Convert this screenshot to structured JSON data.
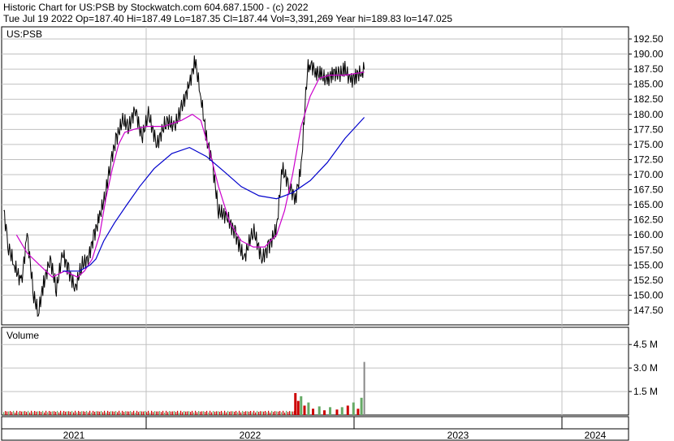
{
  "header": {
    "title": "Historic Chart for US:PSB by Stockwatch.com 604.687.1500 - (c) 2022",
    "stats": "Tue Jul 19 2022   Op=187.40   Hi=187.49   Lo=187.35   Cl=187.44   Vol=3,391,269   Year hi=189.83   lo=147.025"
  },
  "colors": {
    "price": "#000000",
    "ma_short": "#cc00cc",
    "ma_long": "#0000cc",
    "vol_up": "#66aa66",
    "vol_down": "#cc0000",
    "grid": "#c0c0c0",
    "last_volume": "#888888"
  },
  "chart_data": [
    {
      "type": "line",
      "label": "US:PSB",
      "x_axis": {
        "labels": [
          "2021",
          "2022",
          "2023",
          "2024"
        ],
        "year_start_dates": [
          "2021-01-01",
          "2022-01-01",
          "2023-01-01",
          "2024-01-01",
          "2024-12-31"
        ]
      },
      "y_axis": {
        "ticks": [
          "192.50",
          "190.00",
          "187.50",
          "185.00",
          "182.50",
          "180.00",
          "177.50",
          "175.00",
          "172.50",
          "170.00",
          "167.50",
          "165.00",
          "162.50",
          "160.00",
          "157.50",
          "155.00",
          "152.50",
          "150.00",
          "147.50"
        ],
        "range": [
          145.0,
          193.5
        ]
      },
      "grid": true,
      "series": [
        {
          "role": "price",
          "points": [
            [
              "2020-07-20",
              164
            ],
            [
              "2020-08-01",
              158
            ],
            [
              "2020-08-15",
              155
            ],
            [
              "2020-09-01",
              152
            ],
            [
              "2020-09-15",
              160
            ],
            [
              "2020-10-01",
              150
            ],
            [
              "2020-10-12",
              147
            ],
            [
              "2020-10-25",
              152
            ],
            [
              "2020-11-10",
              156
            ],
            [
              "2020-11-25",
              151
            ],
            [
              "2020-12-10",
              157
            ],
            [
              "2020-12-25",
              154
            ],
            [
              "2021-01-10",
              151
            ],
            [
              "2021-01-25",
              155
            ],
            [
              "2021-02-10",
              156
            ],
            [
              "2021-02-25",
              160
            ],
            [
              "2021-03-10",
              163
            ],
            [
              "2021-03-25",
              167
            ],
            [
              "2021-04-05",
              172
            ],
            [
              "2021-04-20",
              176
            ],
            [
              "2021-05-05",
              179
            ],
            [
              "2021-05-20",
              178
            ],
            [
              "2021-06-05",
              181
            ],
            [
              "2021-06-20",
              176
            ],
            [
              "2021-07-05",
              180
            ],
            [
              "2021-07-20",
              175
            ],
            [
              "2021-08-05",
              179
            ],
            [
              "2021-08-20",
              178
            ],
            [
              "2021-09-01",
              181
            ],
            [
              "2021-09-15",
              185
            ],
            [
              "2021-09-25",
              189
            ],
            [
              "2021-10-05",
              183
            ],
            [
              "2021-10-15",
              176
            ],
            [
              "2021-10-25",
              172
            ],
            [
              "2021-11-05",
              164
            ],
            [
              "2021-11-20",
              163
            ],
            [
              "2021-12-05",
              160
            ],
            [
              "2021-12-20",
              156
            ],
            [
              "2022-01-05",
              161
            ],
            [
              "2022-01-20",
              156
            ],
            [
              "2022-02-01",
              158
            ],
            [
              "2022-02-15",
              161
            ],
            [
              "2022-02-25",
              171
            ],
            [
              "2022-03-10",
              168
            ],
            [
              "2022-03-20",
              166
            ],
            [
              "2022-03-30",
              171
            ],
            [
              "2022-04-10",
              187.5
            ],
            [
              "2022-04-15",
              188.5
            ],
            [
              "2022-04-25",
              187
            ],
            [
              "2022-05-05",
              186.5
            ],
            [
              "2022-05-15",
              185.5
            ],
            [
              "2022-05-25",
              187
            ],
            [
              "2022-06-05",
              186.5
            ],
            [
              "2022-06-15",
              187.5
            ],
            [
              "2022-06-25",
              185.5
            ],
            [
              "2022-07-05",
              186.5
            ],
            [
              "2022-07-15",
              187
            ],
            [
              "2022-07-19",
              187.44
            ]
          ]
        },
        {
          "role": "moving-average-short",
          "points": [
            [
              "2020-08-20",
              160
            ],
            [
              "2020-09-15",
              157
            ],
            [
              "2020-10-15",
              155
            ],
            [
              "2020-11-15",
              153
            ],
            [
              "2020-12-15",
              154
            ],
            [
              "2021-01-15",
              153
            ],
            [
              "2021-02-01",
              154
            ],
            [
              "2021-02-20",
              156
            ],
            [
              "2021-03-10",
              160
            ],
            [
              "2021-03-25",
              166
            ],
            [
              "2021-04-10",
              171
            ],
            [
              "2021-04-25",
              175
            ],
            [
              "2021-05-10",
              177
            ],
            [
              "2021-06-01",
              177.5
            ],
            [
              "2021-07-01",
              178
            ],
            [
              "2021-08-01",
              178
            ],
            [
              "2021-09-01",
              179
            ],
            [
              "2021-09-20",
              180
            ],
            [
              "2021-10-05",
              179
            ],
            [
              "2021-10-20",
              174
            ],
            [
              "2021-11-05",
              168
            ],
            [
              "2021-11-25",
              162
            ],
            [
              "2021-12-15",
              159
            ],
            [
              "2022-01-05",
              158
            ],
            [
              "2022-01-25",
              158
            ],
            [
              "2022-02-15",
              160
            ],
            [
              "2022-03-01",
              164
            ],
            [
              "2022-03-15",
              170
            ],
            [
              "2022-03-30",
              178
            ],
            [
              "2022-04-15",
              183
            ],
            [
              "2022-05-01",
              186
            ],
            [
              "2022-05-20",
              186.5
            ],
            [
              "2022-06-15",
              186.5
            ],
            [
              "2022-07-19",
              187
            ]
          ]
        },
        {
          "role": "moving-average-long",
          "points": [
            [
              "2020-12-10",
              154
            ],
            [
              "2021-01-20",
              154
            ],
            [
              "2021-02-15",
              155
            ],
            [
              "2021-03-01",
              156
            ],
            [
              "2021-03-20",
              159
            ],
            [
              "2021-04-15",
              162
            ],
            [
              "2021-05-15",
              165
            ],
            [
              "2021-06-15",
              168
            ],
            [
              "2021-07-15",
              171
            ],
            [
              "2021-08-15",
              173.5
            ],
            [
              "2021-09-15",
              174.5
            ],
            [
              "2021-10-15",
              173
            ],
            [
              "2021-11-15",
              170.5
            ],
            [
              "2021-12-15",
              168
            ],
            [
              "2022-01-15",
              166.5
            ],
            [
              "2022-02-15",
              166
            ],
            [
              "2022-03-15",
              167
            ],
            [
              "2022-04-15",
              169
            ],
            [
              "2022-05-15",
              172
            ],
            [
              "2022-06-15",
              176
            ],
            [
              "2022-07-19",
              179.5
            ]
          ]
        }
      ]
    },
    {
      "type": "bar",
      "label": "Volume",
      "y_axis": {
        "ticks": [
          "4.5 M",
          "3.0 M",
          "1.5 M"
        ],
        "range": [
          0,
          5.6
        ]
      },
      "grid": true,
      "bars": [
        {
          "date": "2022-03-20",
          "value": 1.4,
          "dir": "down"
        },
        {
          "date": "2022-03-25",
          "value": 0.9,
          "dir": "down"
        },
        {
          "date": "2022-03-30",
          "value": 1.2,
          "dir": "up"
        },
        {
          "date": "2022-04-05",
          "value": 0.6,
          "dir": "down"
        },
        {
          "date": "2022-04-12",
          "value": 0.8,
          "dir": "up"
        },
        {
          "date": "2022-04-20",
          "value": 0.4,
          "dir": "down"
        },
        {
          "date": "2022-05-01",
          "value": 0.55,
          "dir": "up"
        },
        {
          "date": "2022-05-10",
          "value": 0.3,
          "dir": "down"
        },
        {
          "date": "2022-05-20",
          "value": 0.5,
          "dir": "up"
        },
        {
          "date": "2022-06-01",
          "value": 0.35,
          "dir": "down"
        },
        {
          "date": "2022-06-10",
          "value": 0.5,
          "dir": "up"
        },
        {
          "date": "2022-06-20",
          "value": 0.6,
          "dir": "down"
        },
        {
          "date": "2022-06-30",
          "value": 0.8,
          "dir": "up"
        },
        {
          "date": "2022-07-08",
          "value": 0.4,
          "dir": "down"
        },
        {
          "date": "2022-07-14",
          "value": 1.1,
          "dir": "up"
        },
        {
          "date": "2022-07-19",
          "value": 3.39,
          "dir": "last"
        }
      ],
      "baseline_value": 0.15
    }
  ]
}
